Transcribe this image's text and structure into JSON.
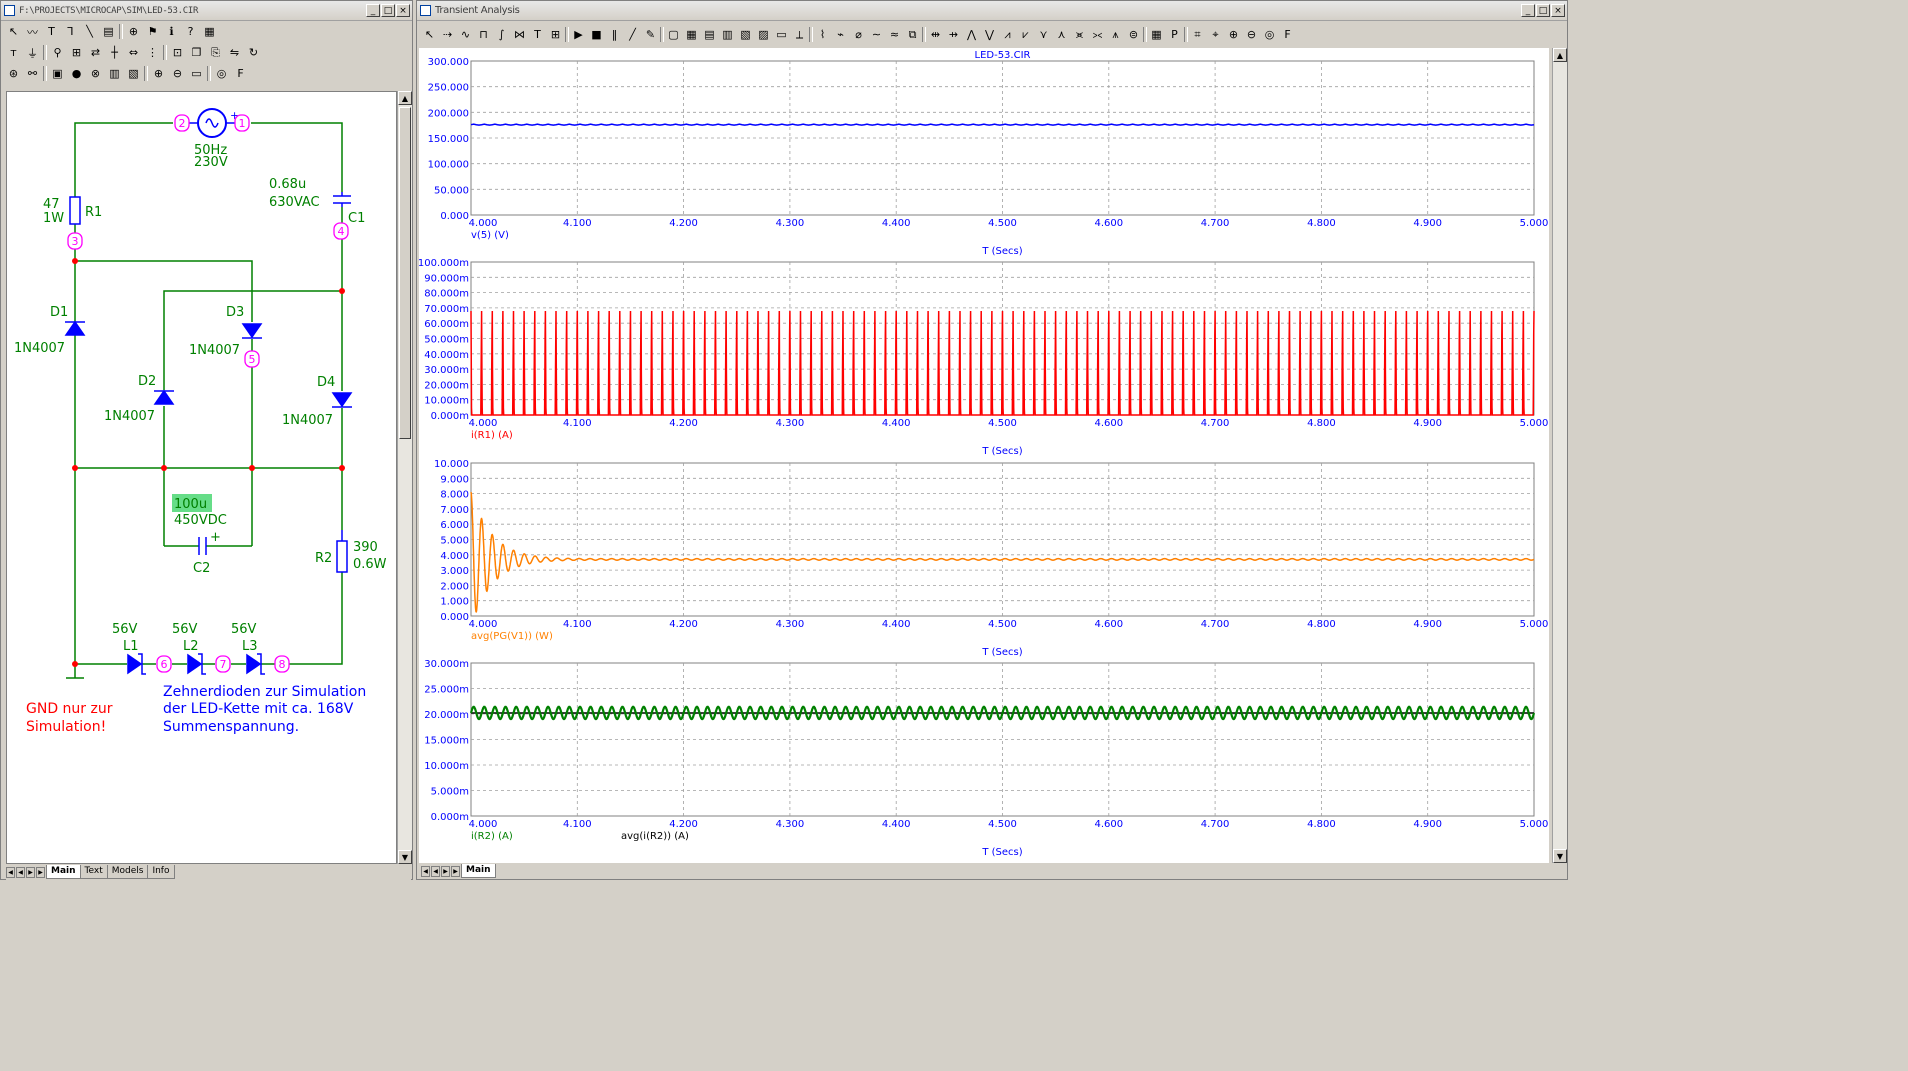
{
  "schematic_window": {
    "title": "F:\\PROJECTS\\MICROCAP\\SIM\\LED-53.CIR",
    "min_btn": "_",
    "max_btn": "□",
    "close_btn": "×",
    "tabs": [
      "Main",
      "Text",
      "Models",
      "Info"
    ],
    "toolbar1": [
      {
        "icon": "arrow-select-icon",
        "glyph": "↖"
      },
      {
        "icon": "wire-icon",
        "glyph": "〰"
      },
      {
        "icon": "text-tool-icon",
        "glyph": "T"
      },
      {
        "icon": "bus-icon",
        "glyph": "Ꞁ"
      },
      {
        "icon": "line-icon",
        "glyph": "╲"
      },
      {
        "icon": "note-icon",
        "glyph": "▤"
      },
      {
        "icon": "component-icon",
        "glyph": "⊕"
      },
      {
        "icon": "flag-icon",
        "glyph": "⚑"
      },
      {
        "icon": "info-icon",
        "glyph": "ℹ"
      },
      {
        "icon": "help-icon",
        "glyph": "?"
      },
      {
        "icon": "grid-icon",
        "glyph": "▦"
      }
    ],
    "toolbar2": [
      {
        "icon": "text-label-icon",
        "glyph": "ᴛ"
      },
      {
        "icon": "ground-icon",
        "glyph": "⏚"
      },
      {
        "icon": "probe-icon",
        "glyph": "⚲"
      },
      {
        "icon": "node-icon",
        "glyph": "⊞"
      },
      {
        "icon": "swap-icon",
        "glyph": "⇄"
      },
      {
        "icon": "junction-icon",
        "glyph": "┼"
      },
      {
        "icon": "flip-icon",
        "glyph": "⇔"
      },
      {
        "icon": "dots-icon",
        "glyph": "⋮"
      },
      {
        "icon": "cut-icon",
        "glyph": "⊡"
      },
      {
        "icon": "copy-icon",
        "glyph": "❐"
      },
      {
        "icon": "paste-icon",
        "glyph": "⎘"
      },
      {
        "icon": "mirror-icon",
        "glyph": "⇋"
      },
      {
        "icon": "rotate-icon",
        "glyph": "↻"
      }
    ],
    "toolbar3": [
      {
        "icon": "show-icon",
        "glyph": "⊛"
      },
      {
        "icon": "binoculars-icon",
        "glyph": "⚯"
      },
      {
        "icon": "monitor-icon",
        "glyph": "▣"
      },
      {
        "icon": "stop-icon",
        "glyph": "●"
      },
      {
        "icon": "cancel-icon",
        "glyph": "⊗"
      },
      {
        "icon": "stack-icon",
        "glyph": "▥"
      },
      {
        "icon": "stack2-icon",
        "glyph": "▧"
      },
      {
        "icon": "zoom-in-icon",
        "glyph": "⊕"
      },
      {
        "icon": "zoom-out-icon",
        "glyph": "⊖"
      },
      {
        "icon": "camera-icon",
        "glyph": "▭"
      },
      {
        "icon": "globe-icon",
        "glyph": "◎"
      },
      {
        "icon": "font-icon",
        "glyph": "F"
      }
    ],
    "labels": {
      "src_freq": "50Hz",
      "src_volt": "230V",
      "r1_val1": "47",
      "r1_val2": "1W",
      "r1_name": "R1",
      "c1_val1": "0.68u",
      "c1_val2": "630VAC",
      "c1_name": "C1",
      "d1_name": "D1",
      "d1_model": "1N4007",
      "d2_name": "D2",
      "d2_model": "1N4007",
      "d3_name": "D3",
      "d3_model": "1N4007",
      "d4_name": "D4",
      "d4_model": "1N4007",
      "c2_val1": "100u",
      "c2_val2": "450VDC",
      "c2_name": "C2",
      "c2_plus": "+",
      "src_plus": "+",
      "r2_name": "R2",
      "r2_val1": "390",
      "r2_val2": "0.6W",
      "l1_volt": "56V",
      "l1_name": "L1",
      "l2_volt": "56V",
      "l2_name": "L2",
      "l3_volt": "56V",
      "l3_name": "L3",
      "gnd_line1": "GND nur zur",
      "gnd_line2": "Simulation!",
      "note_line1": "Zehnerdioden zur Simulation",
      "note_line2": "der LED-Kette mit ca. 168V",
      "note_line3": "Summenspannung."
    },
    "nodes": [
      "2",
      "1",
      "3",
      "4",
      "5",
      "6",
      "7",
      "8"
    ],
    "colors": {
      "wire": "#008000",
      "component": "#0000ff",
      "node": "#ff00ff",
      "note_blue": "#0000ff",
      "note_red": "#ff0000",
      "highlight": "#66dd88"
    }
  },
  "analysis_window": {
    "title": "Transient Analysis",
    "min_btn": "_",
    "max_btn": "□",
    "close_btn": "×",
    "tab": "Main",
    "toolbar": [
      {
        "icon": "arrow-select-icon",
        "glyph": "↖"
      },
      {
        "icon": "cursor-mode-icon",
        "glyph": "⇢"
      },
      {
        "icon": "scale-icon",
        "glyph": "∿"
      },
      {
        "icon": "peak-icon",
        "glyph": "⊓"
      },
      {
        "icon": "data-points-icon",
        "glyph": "∫"
      },
      {
        "icon": "tokens-icon",
        "glyph": "⋈"
      },
      {
        "icon": "text-tool-icon",
        "glyph": "T"
      },
      {
        "icon": "graph-icon",
        "glyph": "⊞"
      },
      {
        "icon": "run-icon",
        "glyph": "▶"
      },
      {
        "icon": "stop-icon",
        "glyph": "■"
      },
      {
        "icon": "pause-icon",
        "glyph": "‖"
      },
      {
        "icon": "line-icon",
        "glyph": "╱"
      },
      {
        "icon": "pen-icon",
        "glyph": "✎"
      },
      {
        "icon": "box-icon",
        "glyph": "▢"
      },
      {
        "icon": "grid-icon",
        "glyph": "▦"
      },
      {
        "icon": "table-icon",
        "glyph": "▤"
      },
      {
        "icon": "table2-icon",
        "glyph": "▥"
      },
      {
        "icon": "table3-icon",
        "glyph": "▧"
      },
      {
        "icon": "table4-icon",
        "glyph": "▨"
      },
      {
        "icon": "window-icon",
        "glyph": "▭"
      },
      {
        "icon": "axes-icon",
        "glyph": "⟂"
      },
      {
        "icon": "wave1-icon",
        "glyph": "⌇"
      },
      {
        "icon": "wave2-icon",
        "glyph": "⌁"
      },
      {
        "icon": "wave3-icon",
        "glyph": "⌀"
      },
      {
        "icon": "wave4-icon",
        "glyph": "∼"
      },
      {
        "icon": "wave5-icon",
        "glyph": "≈"
      },
      {
        "icon": "zoom-window-icon",
        "glyph": "⧉"
      },
      {
        "icon": "cursor-left-icon",
        "glyph": "⇹"
      },
      {
        "icon": "cursor-right-icon",
        "glyph": "⇸"
      },
      {
        "icon": "peak-icon",
        "glyph": "⋀"
      },
      {
        "icon": "valley-icon",
        "glyph": "⋁"
      },
      {
        "icon": "high-icon",
        "glyph": "⩘"
      },
      {
        "icon": "low-icon",
        "glyph": "⩗"
      },
      {
        "icon": "inflect-icon",
        "glyph": "⋎"
      },
      {
        "icon": "slope-icon",
        "glyph": "⋏"
      },
      {
        "icon": "next-icon",
        "glyph": "⪤"
      },
      {
        "icon": "prev-icon",
        "glyph": "⪥"
      },
      {
        "icon": "all-icon",
        "glyph": "⩚"
      },
      {
        "icon": "stack-icon",
        "glyph": "⊜"
      },
      {
        "icon": "table-out-icon",
        "glyph": "▦"
      },
      {
        "icon": "param-icon",
        "glyph": "P"
      },
      {
        "icon": "tag-icon",
        "glyph": "⌗"
      },
      {
        "icon": "tag2-icon",
        "glyph": "⌖"
      },
      {
        "icon": "zoom-in-icon",
        "glyph": "⊕"
      },
      {
        "icon": "zoom-out-icon",
        "glyph": "⊖"
      },
      {
        "icon": "globe-icon",
        "glyph": "◎"
      },
      {
        "icon": "font-icon",
        "glyph": "F"
      }
    ],
    "plot_title": "LED-53.CIR",
    "x_axis_label": "T (Secs)",
    "x_ticks": [
      "4.000",
      "4.100",
      "4.200",
      "4.300",
      "4.400",
      "4.500",
      "4.600",
      "4.700",
      "4.800",
      "4.900",
      "5.000"
    ]
  },
  "chart_data": [
    {
      "type": "line",
      "title": "LED-53.CIR",
      "xlabel": "T (Secs)",
      "ylabel": "",
      "xlim": [
        4.0,
        5.0
      ],
      "ylim": [
        0,
        300
      ],
      "y_ticks": [
        "300.000",
        "250.000",
        "200.000",
        "150.000",
        "100.000",
        "50.000",
        "0.000"
      ],
      "grid": true,
      "series": [
        {
          "name": "v(5) (V)",
          "color": "#0000ff",
          "shape": "constant",
          "level": 176
        }
      ]
    },
    {
      "type": "line",
      "title": "",
      "xlabel": "T (Secs)",
      "ylabel": "",
      "xlim": [
        4.0,
        5.0
      ],
      "ylim": [
        0,
        0.1
      ],
      "y_ticks": [
        "100.000m",
        "90.000m",
        "80.000m",
        "70.000m",
        "60.000m",
        "50.000m",
        "40.000m",
        "30.000m",
        "20.000m",
        "10.000m",
        "0.000m"
      ],
      "grid": true,
      "series": [
        {
          "name": "i(R1) (A)",
          "color": "#ff0000",
          "shape": "pulses",
          "peak": 0.068,
          "frequency_hz": 100
        }
      ]
    },
    {
      "type": "line",
      "title": "",
      "xlabel": "T (Secs)",
      "ylabel": "",
      "xlim": [
        4.0,
        5.0
      ],
      "ylim": [
        0,
        10
      ],
      "y_ticks": [
        "10.000",
        "9.000",
        "8.000",
        "7.000",
        "6.000",
        "5.000",
        "4.000",
        "3.000",
        "2.000",
        "1.000",
        "0.000"
      ],
      "grid": true,
      "series": [
        {
          "name": "avg(PG(V1)) (W)",
          "color": "#ff8000",
          "shape": "damped",
          "start": 8.1,
          "final": 3.7
        }
      ]
    },
    {
      "type": "line",
      "title": "",
      "xlabel": "T (Secs)",
      "ylabel": "",
      "xlim": [
        4.0,
        5.0
      ],
      "ylim": [
        0,
        0.03
      ],
      "y_ticks": [
        "30.000m",
        "25.000m",
        "20.000m",
        "15.000m",
        "10.000m",
        "5.000m",
        "0.000m"
      ],
      "grid": true,
      "series": [
        {
          "name": "i(R2) (A)",
          "color": "#008000",
          "shape": "ripple",
          "center": 0.0202,
          "amplitude": 0.0012,
          "frequency_hz": 100
        },
        {
          "name": "avg(i(R2)) (A)",
          "color": "#000000",
          "shape": "constant",
          "level": 0.0202
        }
      ]
    }
  ]
}
